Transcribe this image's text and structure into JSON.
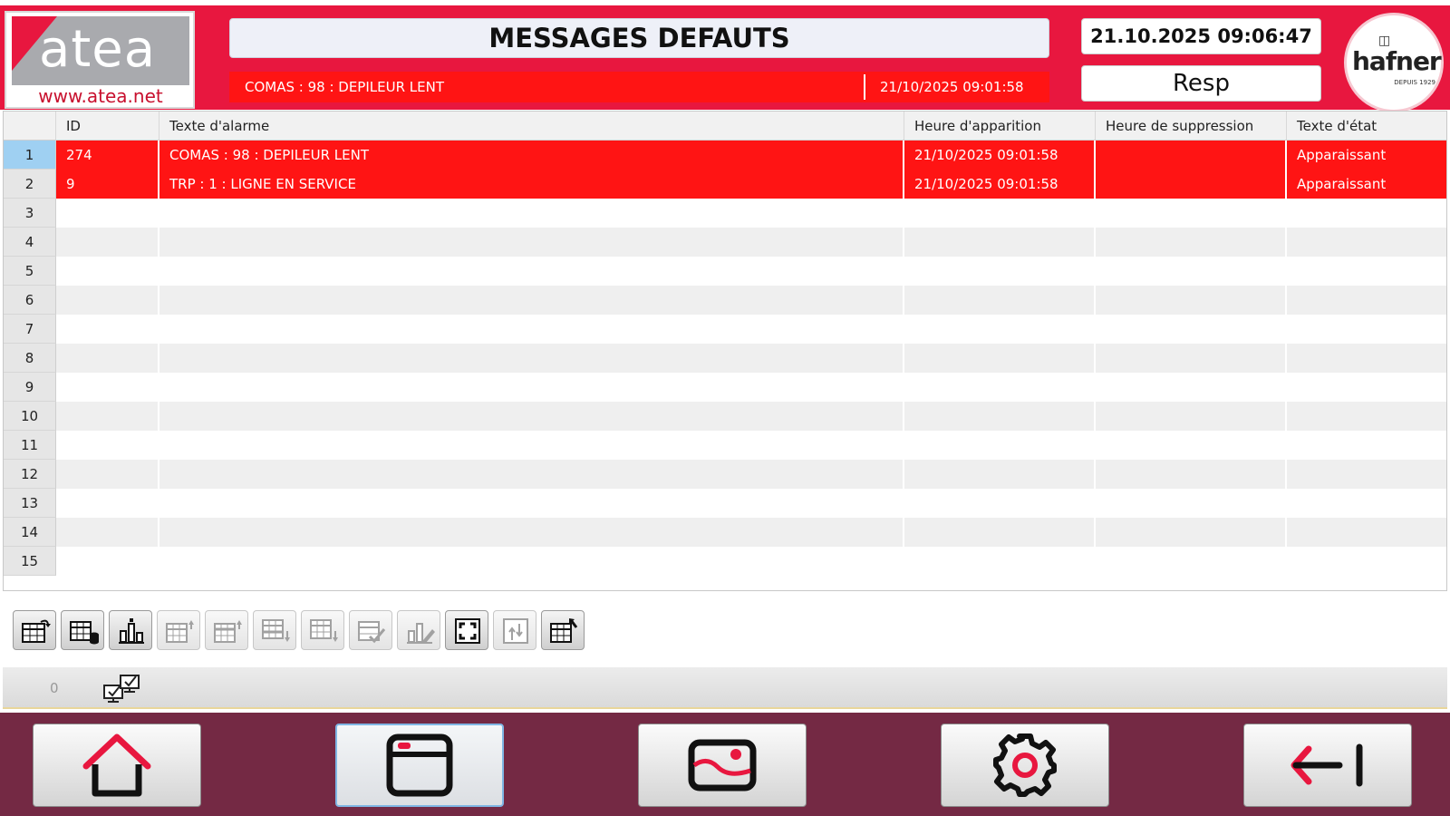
{
  "header": {
    "logo_left": {
      "word": "atea",
      "url": "www.atea.net"
    },
    "title": "MESSAGES DEFAUTS",
    "alarm_banner": {
      "text": "COMAS : 98 : DEPILEUR LENT",
      "time": "21/10/2025 09:01:58"
    },
    "clock": "21.10.2025 09:06:47",
    "user": "Resp",
    "logo_right": {
      "word": "hafner",
      "sub": "DEPUIS 1929"
    }
  },
  "colors": {
    "header_red": "#e8173f",
    "alarm_red": "#ff1414",
    "nav_bg": "#742944",
    "selected_row": "#9fd0f2"
  },
  "table": {
    "columns": [
      "",
      "ID",
      "Texte d'alarme",
      "Heure d'apparition",
      "Heure de suppression",
      "Texte d'état"
    ],
    "rows": [
      {
        "num": "1",
        "id": "274",
        "text": "COMAS : 98 : DEPILEUR LENT",
        "appear": "21/10/2025 09:01:58",
        "clear": "",
        "state": "Apparaissant",
        "alarm": true,
        "selected": true
      },
      {
        "num": "2",
        "id": "9",
        "text": "TRP : 1 : LIGNE EN SERVICE",
        "appear": "21/10/2025 09:01:58",
        "clear": "",
        "state": "Apparaissant",
        "alarm": true
      },
      {
        "num": "3"
      },
      {
        "num": "4"
      },
      {
        "num": "5"
      },
      {
        "num": "6"
      },
      {
        "num": "7"
      },
      {
        "num": "8"
      },
      {
        "num": "9"
      },
      {
        "num": "10"
      },
      {
        "num": "11"
      },
      {
        "num": "12"
      },
      {
        "num": "13"
      },
      {
        "num": "14"
      },
      {
        "num": "15"
      }
    ]
  },
  "toolbar": [
    {
      "icon": "table-refresh-icon",
      "enabled": true
    },
    {
      "icon": "table-database-icon",
      "enabled": true
    },
    {
      "icon": "statistics-icon",
      "enabled": true
    },
    {
      "icon": "table-sort-up-icon",
      "enabled": false
    },
    {
      "icon": "table-sort-up-alt-icon",
      "enabled": false
    },
    {
      "icon": "table-sort-down-icon",
      "enabled": false
    },
    {
      "icon": "table-sort-down-alt-icon",
      "enabled": false
    },
    {
      "icon": "table-acknowledge-icon",
      "enabled": false
    },
    {
      "icon": "statistics-edit-icon",
      "enabled": false
    },
    {
      "icon": "fit-screen-icon",
      "enabled": true
    },
    {
      "icon": "scroll-lock-icon",
      "enabled": false
    },
    {
      "icon": "table-undo-icon",
      "enabled": true
    }
  ],
  "statusbar": {
    "count": "0",
    "icon": "acknowledge-all-icon"
  },
  "bottom_nav": [
    {
      "name": "home",
      "icon": "home-icon"
    },
    {
      "name": "alarms",
      "icon": "window-icon",
      "active": true
    },
    {
      "name": "images",
      "icon": "image-icon"
    },
    {
      "name": "settings",
      "icon": "gear-icon"
    },
    {
      "name": "logout",
      "icon": "exit-icon"
    }
  ]
}
